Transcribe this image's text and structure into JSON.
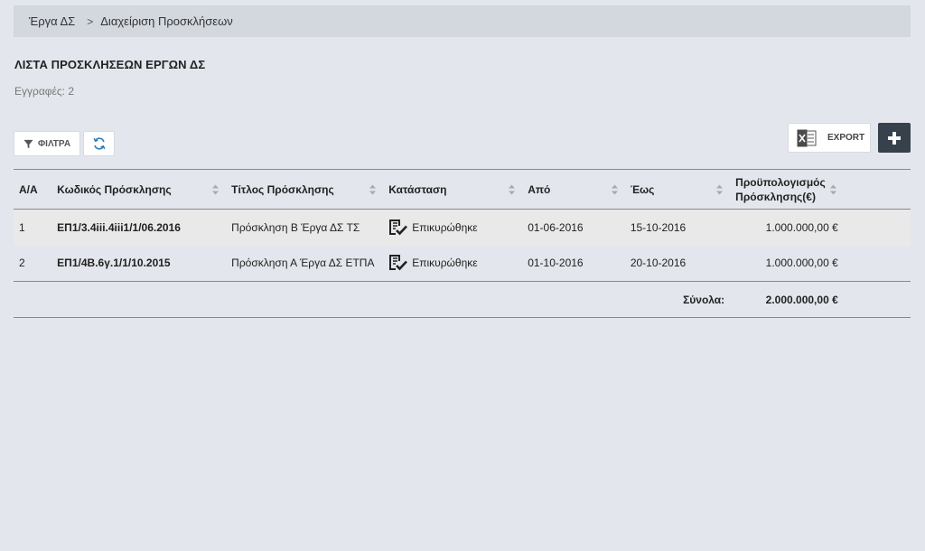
{
  "breadcrumb": {
    "items": [
      "Έργα ΔΣ",
      "Διαχείριση Προσκλήσεων"
    ],
    "separator": ">"
  },
  "page": {
    "title": "ΛΙΣΤΑ ΠΡΟΣΚΛΗΣΕΩΝ ΕΡΓΩΝ ΔΣ",
    "records_label": "Εγγραφές: 2"
  },
  "toolbar": {
    "filter_label": "ΦΙΛΤΡΑ",
    "export_label": "EXPORT",
    "icons": [
      "filter-icon",
      "refresh-icon",
      "excel-icon",
      "plus-icon"
    ]
  },
  "table": {
    "headers": {
      "aa": "Α/Α",
      "code": "Κωδικός Πρόσκλησης",
      "title": "Τίτλος Πρόσκλησης",
      "status": "Κατάσταση",
      "from": "Από",
      "to": "Έως",
      "budget_line1": "Προϋπολογισμός",
      "budget_line2": "Πρόσκλησης(€)"
    },
    "rows": [
      {
        "aa": "1",
        "code": "ΕΠ1/3.4iii.4iii1/1/06.2016",
        "title": "Πρόσκληση Β Έργα ΔΣ ΤΣ",
        "status": "Επικυρώθηκε",
        "from": "01-06-2016",
        "to": "15-10-2016",
        "budget": "1.000.000,00 €"
      },
      {
        "aa": "2",
        "code": "ΕΠ1/4Β.6γ.1/1/10.2015",
        "title": "Πρόσκληση Α Έργα ΔΣ ΕΤΠΑ",
        "status": "Επικυρώθηκε",
        "from": "01-10-2016",
        "to": "20-10-2016",
        "budget": "1.000.000,00 €"
      }
    ],
    "totals": {
      "label": "Σύνολα:",
      "value": "2.000.000,00 €"
    }
  },
  "colors": {
    "background": "#e3e6ec",
    "breadcrumb_bg": "#d3d7de",
    "add_button": "#37414b",
    "refresh_icon": "#2a7ab8"
  }
}
